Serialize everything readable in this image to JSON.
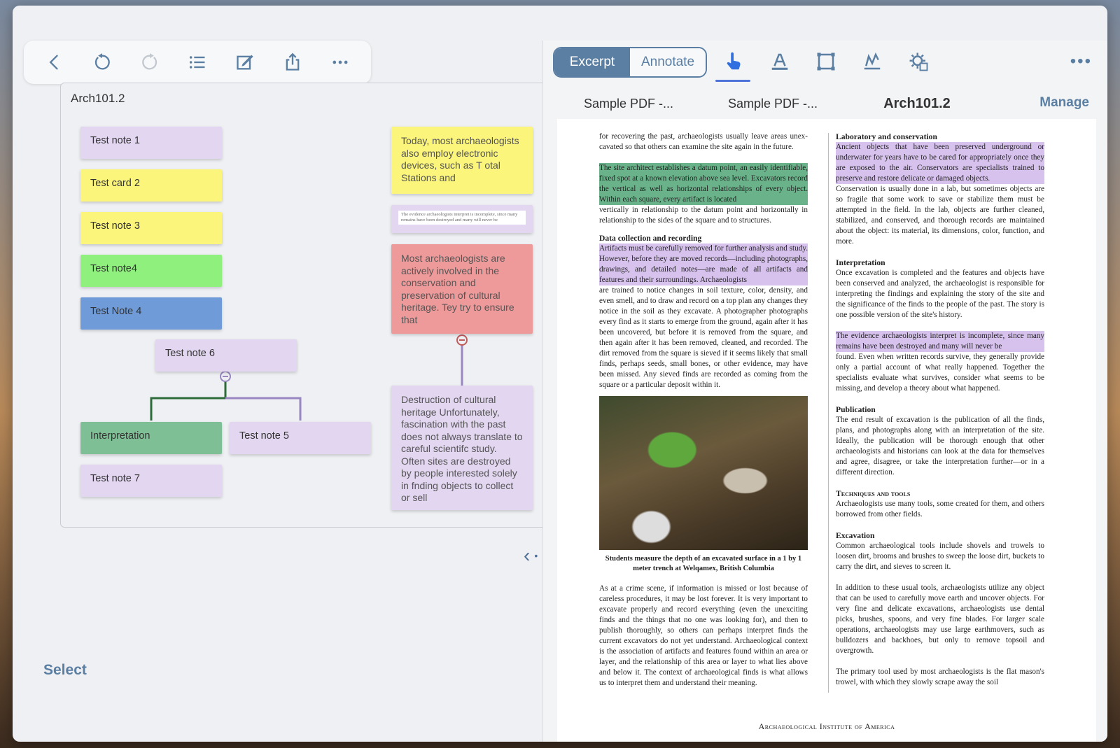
{
  "toolbar_left": {
    "icons": [
      "back-icon",
      "undo-icon",
      "redo-icon",
      "list-icon",
      "edit-icon",
      "share-icon",
      "more-icon"
    ]
  },
  "canvas": {
    "title": "Arch101.2",
    "cards": [
      {
        "text": "Test note 1",
        "color": "#e3d6f1"
      },
      {
        "text": "Test card 2",
        "color": "#fbf57c"
      },
      {
        "text": "Test note 3",
        "color": "#fbf57c"
      },
      {
        "text": "Test note4",
        "color": "#8ff07e"
      },
      {
        "text": "Test Note 4",
        "color": "#6f9bd8"
      },
      {
        "text": "Test note 6",
        "color": "#e3d6f1"
      },
      {
        "text": "Interpretation",
        "color": "#7fbf95"
      },
      {
        "text": "Test note 5",
        "color": "#e3d6f1"
      },
      {
        "text": "Test note 7",
        "color": "#e3d6f1"
      }
    ],
    "side_cards": [
      {
        "text": "Today, most archaeologists also employ electronic devices, such as T otal Stations and",
        "color": "#fbf57c"
      },
      {
        "text": "The evidence archaeologists interpret is incomplete, since many remains have been destroyed and many will never be",
        "color": "#e3d6f1"
      },
      {
        "text": "Most archaeologists are actively involved in the conservation and preservation of cultural heritage. Tey try to ensure that",
        "color": "#ef9a9a"
      },
      {
        "text": "Destruction of cultural heritage Unfortunately, fascination with the past does not always translate to careful scientifc study. Often sites are destroyed by people interested solely in fnding objects to collect or sell",
        "color": "#e3d6f1"
      }
    ]
  },
  "select_label": "Select",
  "right": {
    "segment": {
      "excerpt": "Excerpt",
      "annotate": "Annotate"
    },
    "tools": [
      "hand-pointer-icon",
      "text-highlight-icon",
      "rectangle-select-icon",
      "signature-icon",
      "settings-icon"
    ],
    "tabs": [
      "Sample PDF -...",
      "Sample PDF -...",
      "Arch101.2"
    ],
    "manage": "Manage",
    "pdf": {
      "col1": {
        "p1": "for recovering the past, archaeologists usually leave areas unex­cavated so that others can examine the site again in the future.",
        "hl1": "The site architect establishes a datum point, an easily identifi­able, fixed spot at a known elevation above sea level. Excava­tors record the vertical as well as horizontal relationships of every object. Within each square, every artifact is located",
        "p2": "vertically in relationship to the datum point and horizontally in relationship to the sides of the square and to structures.",
        "h1": "Data collection and recording",
        "hl2": "Artifacts must be carefully removed for further analysis and study. However, before they are moved records—including photographs, drawings, and detailed notes—are made of all artifacts and features and their surroundings. Archaeologists",
        "p3": "are trained to notice changes in soil texture, color, density, and even smell, and to draw and record on a top plan any changes they notice in the soil as they excavate. A photographer photo­graphs every find as it starts to emerge from the ground, again after it has been uncovered, but before it is removed from the square, and then again after it has been removed, cleaned, and recorded. The dirt removed from the square is sieved if it seems likely that small finds, perhaps seeds, small bones, or other evi­dence, may have been missed. Any sieved finds are recorded as coming from the square or a particular deposit within it.",
        "caption": "Students measure the depth of an excavated surface in a 1 by 1 meter trench at Welqamex, British Columbia",
        "p4": "As at a crime scene, if information is missed or lost because of careless procedures, it may be lost forever. It is very important to excavate properly and record everything (even the unexciting finds and the things that no one was looking for), and then to publish thoroughly, so others can perhaps interpret finds the current excavators do not yet understand. Archaeological con­text is the association of artifacts and features found within an area or layer, and the relationship of this area or layer to what lies above and below it. The context of archaeological finds is what allows us to interpret them and understand their meaning."
      },
      "col2": {
        "h1": "Laboratory and conservation",
        "hl1": "Ancient objects that have been preserved underground or underwater for years have to be cared for appropriately once they are exposed to the air. Conservators are specialists trained to preserve and restore delicate or damaged objects.",
        "p1": "Conservation is usually done in a lab, but sometimes objects are so fragile that some work to save or stabilize them must be attempted in the field. In the lab, objects are further cleaned, stabilized, and conserved, and thorough records are main­tained about the object: its material, its dimensions, color, function, and more.",
        "h2": "Interpretation",
        "p2": "Once excavation is completed and the features and objects have been conserved and analyzed, the archaeologist is responsible for interpreting the findings and explaining the story of the site and the significance of the finds to the people of the past. The story is one possible version of the site's history.",
        "hl2": "The evidence archaeologists interpret is incomplete, since many remains have been destroyed and many will never be",
        "p3": "found. Even when written records survive, they generally pro­vide only a partial account of what really happened. Together the specialists evaluate what survives, consider what seems to be missing, and develop a theory about what happened.",
        "h3": "Publication",
        "p4": "The end result of excavation is the publication of all the finds, plans, and photographs along with an interpretation of the site. Ideally, the publication will be thorough enough that other archaeologists and historians can look at the data for themselves and agree, disagree, or take the interpretation further—or in a different direction.",
        "h4": "Techniques and tools",
        "p5": "Archaeologists use many tools, some created for them, and others borrowed from other fields.",
        "h5": "Excavation",
        "p6": "Common archaeological tools include shovels and trowels to loosen dirt, brooms and brushes to sweep the loose dirt, buckets to carry the dirt, and sieves to screen it.",
        "p7": "In addition to these usual tools, archaeologists utilize any object that can be used to carefully move earth and uncover objects. For very fine and delicate excavations, archaeologists use dental picks, brushes, spoons, and very fine blades. For larger scale operations, archaeologists may use large earth­movers, such as bulldozers and backhoes, but only to remove topsoil and overgrowth.",
        "p8": "The primary tool used by most archaeologists is the flat mason's trowel, with which they slowly scrape away the soil"
      },
      "footer": "Archaeological Institute of America"
    }
  }
}
